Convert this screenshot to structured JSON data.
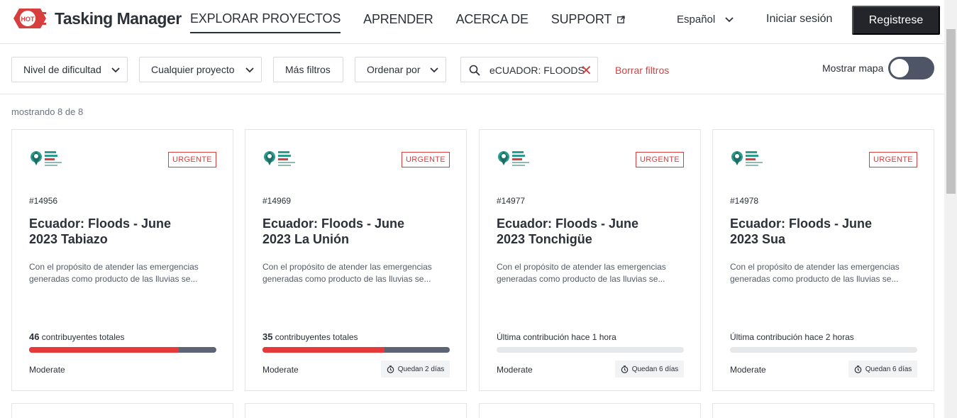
{
  "header": {
    "logo_text": "Tasking Manager",
    "logo_badge": "HOT",
    "nav": [
      {
        "label": "EXPLORAR PROYECTOS",
        "active": true
      },
      {
        "label": "APRENDER"
      },
      {
        "label": "ACERCA DE"
      },
      {
        "label": "SUPPORT",
        "external": true
      }
    ],
    "language": "Español",
    "login": "Iniciar sesión",
    "register": "Registrese"
  },
  "filters": {
    "difficulty": "Nivel de dificultad",
    "project": "Cualquier proyecto",
    "more": "Más filtros",
    "order": "Ordenar por",
    "search_value": "eCUADOR: FLOODS",
    "clear": "Borrar filtros",
    "show_map": "Mostrar mapa",
    "map_toggle_on": false
  },
  "results": {
    "count_text": "mostrando 8 de 8"
  },
  "cards": [
    {
      "id": "#14956",
      "title": "Ecuador: Floods - June 2023 Tabiazo",
      "badge": "URGENTE",
      "desc": "Con el propósito de atender las emergencias generadas como producto de las lluvias se...",
      "stat_num": "46",
      "stat_text": " contribuyentes totales",
      "progress": 0.8,
      "level": "Moderate",
      "days": ""
    },
    {
      "id": "#14969",
      "title": "Ecuador: Floods - June 2023 La Unión",
      "badge": "URGENTE",
      "desc": "Con el propósito de atender las emergencias generadas como producto de las lluvias se...",
      "stat_num": "35",
      "stat_text": " contribuyentes totales",
      "progress": 0.65,
      "level": "Moderate",
      "days": "Quedan 2 días"
    },
    {
      "id": "#14977",
      "title": "Ecuador: Floods - June 2023 Tonchigüe",
      "badge": "URGENTE",
      "desc": "Con el propósito de atender las emergencias generadas como producto de las lluvias se...",
      "stat_num": "",
      "stat_text": "Última contribución hace 1 hora",
      "progress": 0,
      "level": "Moderate",
      "days": "Quedan 6 días"
    },
    {
      "id": "#14978",
      "title": "Ecuador: Floods - June 2023 Sua",
      "badge": "URGENTE",
      "desc": "Con el propósito de atender las emergencias generadas como producto de las lluvias se...",
      "stat_num": "",
      "stat_text": "Última contribución hace 2 horas",
      "progress": 0,
      "level": "Moderate",
      "days": "Quedan 6 días"
    }
  ],
  "colors": {
    "accent": "#d73f3f",
    "progress_fill": "#e63a3a",
    "progress_track": "#5b6575",
    "dark": "#24252a"
  }
}
